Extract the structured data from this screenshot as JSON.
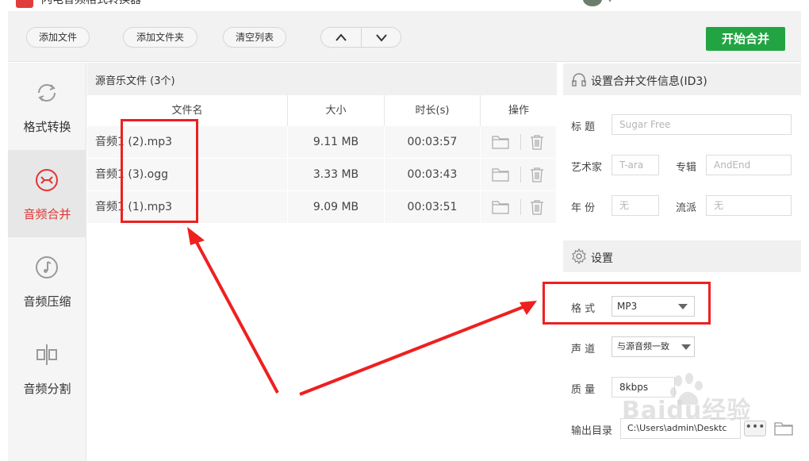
{
  "app": {
    "title": "闪电音频格式转换器"
  },
  "toolbar": {
    "add_file": "添加文件",
    "add_folder": "添加文件夹",
    "clear_list": "清空列表",
    "start": "开始合并",
    "accent": "#22a443"
  },
  "sidebar": {
    "items": [
      {
        "label": "格式转换",
        "icon": "refresh-icon",
        "active": false
      },
      {
        "label": "音频合并",
        "icon": "merge-icon",
        "active": true
      },
      {
        "label": "音频压缩",
        "icon": "music-note-icon",
        "active": false
      },
      {
        "label": "音频分割",
        "icon": "split-icon",
        "active": false
      }
    ],
    "active_color": "#e23434"
  },
  "file_list": {
    "header": "源音乐文件 (3个)",
    "columns": [
      "文件名",
      "大小",
      "时长(s)",
      "操作"
    ],
    "rows": [
      {
        "name": "音频1 (2).mp3",
        "size": "9.11 MB",
        "duration": "00:03:57"
      },
      {
        "name": "音频1 (3).ogg",
        "size": "3.33 MB",
        "duration": "00:03:43"
      },
      {
        "name": "音频1 (1).mp3",
        "size": "9.09 MB",
        "duration": "00:03:51"
      }
    ]
  },
  "id3": {
    "header": "设置合并文件信息(ID3)",
    "title_label": "标  题",
    "title_placeholder": "Sugar Free",
    "artist_label": "艺术家",
    "artist_placeholder": "T-ara",
    "album_label": "专辑",
    "album_placeholder": "AndEnd",
    "year_label": "年  份",
    "year_placeholder": "无",
    "genre_label": "流派",
    "genre_placeholder": "无"
  },
  "settings": {
    "header": "设置",
    "format_label": "格  式",
    "format_value": "MP3",
    "channel_label": "声  道",
    "channel_value": "与源音频一致",
    "quality_label": "质  量",
    "quality_value": "8kbps",
    "output_label": "输出目录",
    "output_value": "C:\\Users\\admin\\Desktc",
    "more": "•••"
  },
  "watermark": "Baidu经验",
  "annotation_color": "#ee2020"
}
